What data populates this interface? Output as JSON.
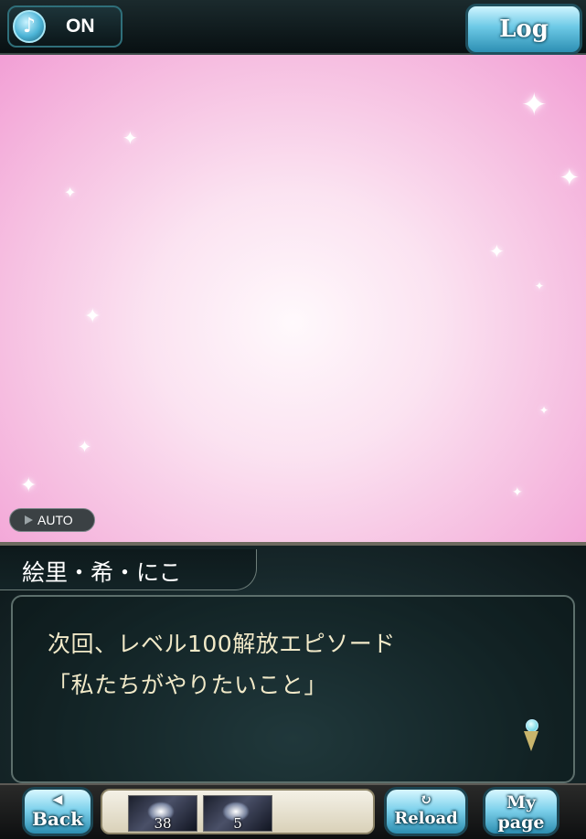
{
  "top_bar": {
    "music_status": "ON",
    "log_label": "Log"
  },
  "scene": {
    "auto_label": "AUTO"
  },
  "dialog": {
    "speaker": "絵里・希・にこ",
    "lines": [
      "次回、レベル100解放エピソード",
      "「私たちがやりたいこと」"
    ]
  },
  "bottom_bar": {
    "back_label": "Back",
    "reload_label": "Reload",
    "mypage_line1": "My",
    "mypage_line2": "page",
    "items": [
      {
        "icon": "item-icon",
        "count": "38"
      },
      {
        "icon": "item-icon",
        "count": "5"
      }
    ]
  },
  "colors": {
    "scene_pink": "#f29fd5",
    "dialog_text": "#f1e9c8",
    "button_cyan": "#7fd2ec"
  },
  "icons": [
    "music-note-icon",
    "play-triangle-icon",
    "next-indicator-icon",
    "back-arrow-icon",
    "reload-icon"
  ]
}
